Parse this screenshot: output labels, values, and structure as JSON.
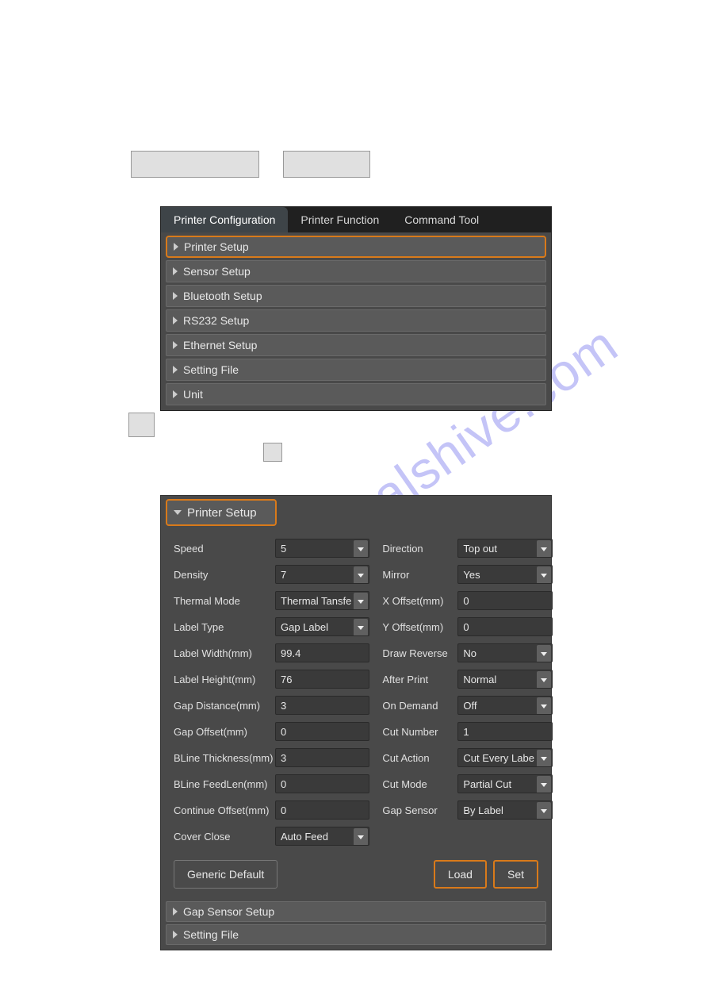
{
  "watermark": "manualshive.com",
  "panel1": {
    "tabs": {
      "t0": "Printer Configuration",
      "t1": "Printer Function",
      "t2": "Command Tool"
    },
    "items": {
      "i0": "Printer Setup",
      "i1": "Sensor Setup",
      "i2": "Bluetooth Setup",
      "i3": "RS232 Setup",
      "i4": "Ethernet Setup",
      "i5": "Setting File",
      "i6": "Unit"
    }
  },
  "panel2": {
    "header": "Printer Setup",
    "left": {
      "speed": {
        "label": "Speed",
        "value": "5"
      },
      "density": {
        "label": "Density",
        "value": "7"
      },
      "thermal_mode": {
        "label": "Thermal Mode",
        "value": "Thermal Tansfe"
      },
      "label_type": {
        "label": "Label Type",
        "value": "Gap Label"
      },
      "label_width": {
        "label": "Label Width(mm)",
        "value": "99.4"
      },
      "label_height": {
        "label": "Label Height(mm)",
        "value": "76"
      },
      "gap_distance": {
        "label": "Gap Distance(mm)",
        "value": "3"
      },
      "gap_offset": {
        "label": "Gap Offset(mm)",
        "value": "0"
      },
      "bline_thick": {
        "label": "BLine Thickness(mm)",
        "value": "3"
      },
      "bline_feed": {
        "label": "BLine FeedLen(mm)",
        "value": "0"
      },
      "cont_offset": {
        "label": "Continue Offset(mm)",
        "value": "0"
      },
      "cover_close": {
        "label": "Cover Close",
        "value": "Auto Feed"
      }
    },
    "right": {
      "direction": {
        "label": "Direction",
        "value": "Top out"
      },
      "mirror": {
        "label": "Mirror",
        "value": "Yes"
      },
      "x_offset": {
        "label": "X Offset(mm)",
        "value": "0"
      },
      "y_offset": {
        "label": "Y Offset(mm)",
        "value": "0"
      },
      "draw_reverse": {
        "label": "Draw Reverse",
        "value": "No"
      },
      "after_print": {
        "label": "After Print",
        "value": "Normal"
      },
      "on_demand": {
        "label": "On Demand",
        "value": "Off"
      },
      "cut_number": {
        "label": "Cut Number",
        "value": "1"
      },
      "cut_action": {
        "label": "Cut Action",
        "value": "Cut Every Labe"
      },
      "cut_mode": {
        "label": "Cut Mode",
        "value": "Partial Cut"
      },
      "gap_sensor": {
        "label": "Gap Sensor",
        "value": "By Label"
      }
    },
    "buttons": {
      "generic": "Generic Default",
      "load": "Load",
      "set": "Set"
    },
    "footer": {
      "f0": "Gap Sensor Setup",
      "f1": "Setting File"
    }
  }
}
